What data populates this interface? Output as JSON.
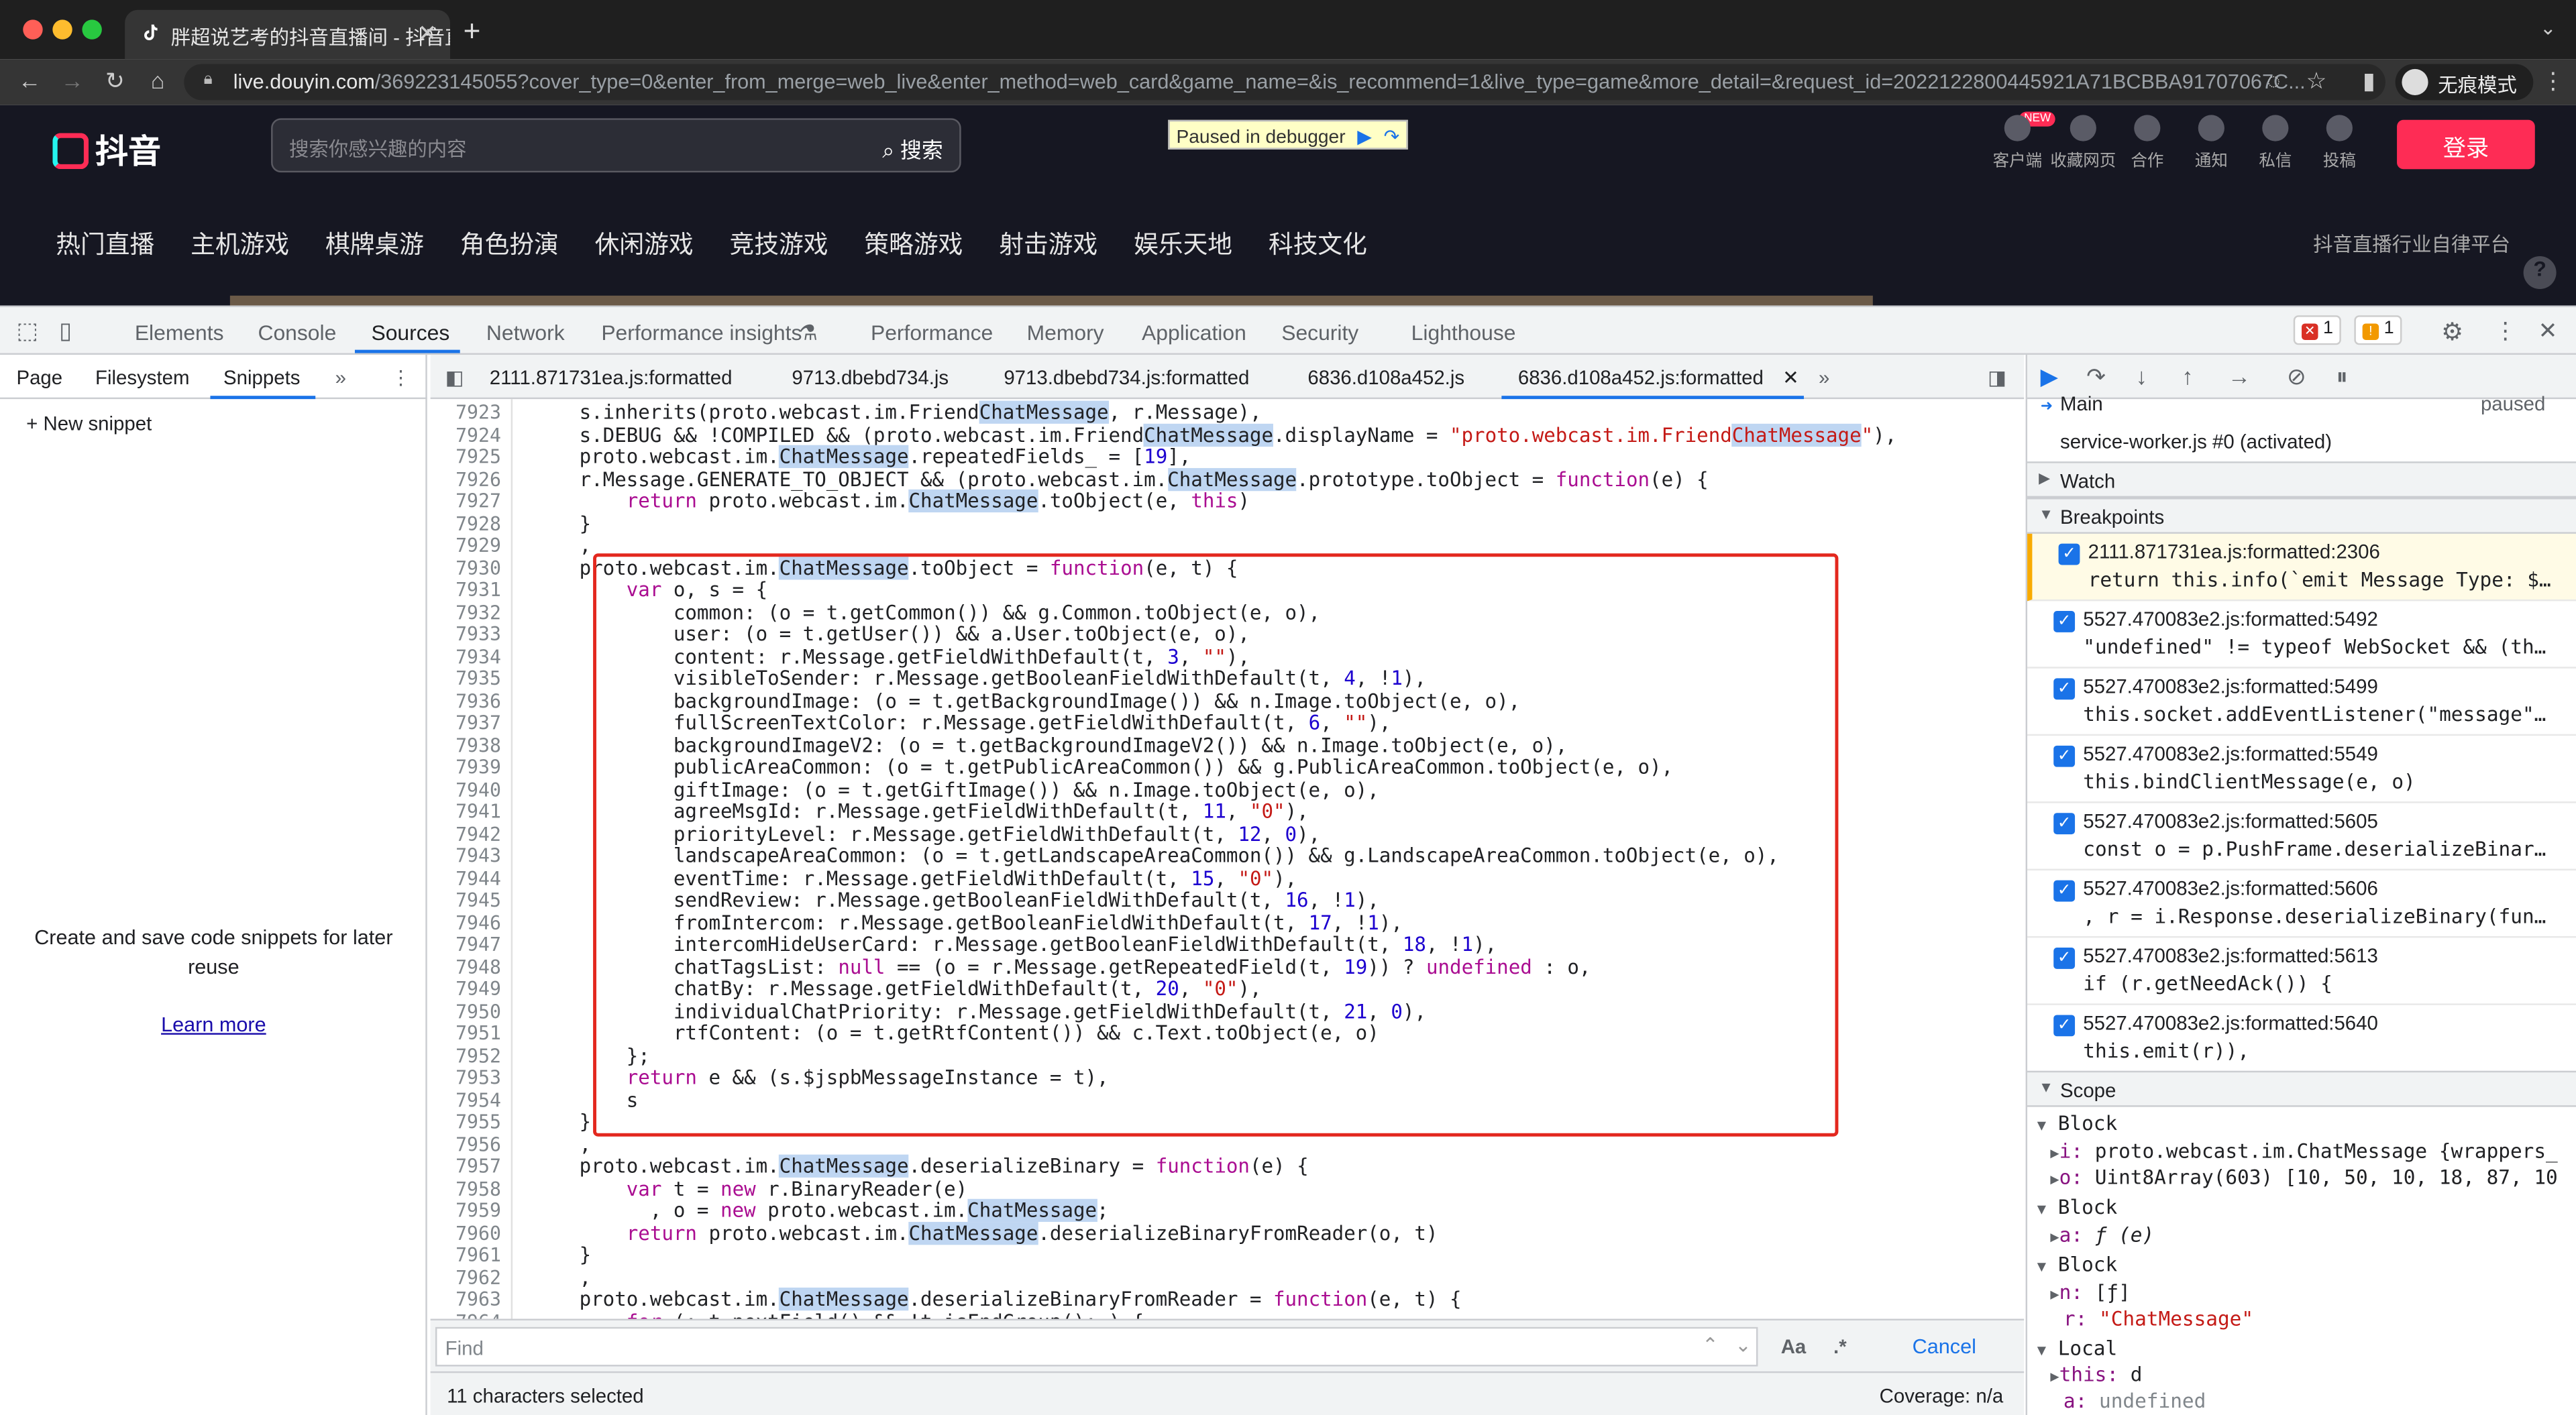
{
  "browser": {
    "tab_title": "胖超说艺考的抖音直播间 - 抖音直播",
    "url_host": "live.douyin.com",
    "url_rest": "/369223145055?cover_type=0&enter_from_merge=web_live&enter_method=web_card&game_name=&is_recommend=1&live_type=game&more_detail=&request_id=2022122800445921A71BCBBA91707067C...",
    "incognito_label": "无痕模式"
  },
  "site": {
    "logo_text": "抖音",
    "search_placeholder": "搜索你感兴趣的内容",
    "search_button": "搜索",
    "paused_label": "Paused in debugger",
    "icons": [
      {
        "label": "客户端",
        "icon": "client-icon"
      },
      {
        "label": "收藏网页",
        "icon": "star-icon"
      },
      {
        "label": "合作",
        "icon": "coop-icon"
      },
      {
        "label": "通知",
        "icon": "bell-icon"
      },
      {
        "label": "私信",
        "icon": "message-icon"
      },
      {
        "label": "投稿",
        "icon": "upload-icon"
      }
    ],
    "new_badge": "NEW",
    "login": "登录",
    "categories": [
      "热门直播",
      "主机游戏",
      "棋牌桌游",
      "角色扮演",
      "休闲游戏",
      "竞技游戏",
      "策略游戏",
      "射击游戏",
      "娱乐天地",
      "科技文化"
    ],
    "self_regulation": "抖音直播行业自律平台",
    "help": "?"
  },
  "devtools": {
    "tabs": [
      "Elements",
      "Console",
      "Sources",
      "Network",
      "Performance insights",
      "Performance",
      "Memory",
      "Application",
      "Security",
      "Lighthouse"
    ],
    "active_tab": "Sources",
    "error_count": "1",
    "warning_count": "1",
    "nav_tabs": [
      "Page",
      "Filesystem",
      "Snippets"
    ],
    "new_snippet": "New snippet",
    "snippet_help": "Create and save code snippets for later reuse",
    "learn_more": "Learn more",
    "editor_tabs": [
      "2111.871731ea.js:formatted",
      "9713.dbebd734.js",
      "9713.dbebd734.js:formatted",
      "6836.d108a452.js",
      "6836.d108a452.js:formatted"
    ],
    "find_placeholder": "Find",
    "find_case": "Aa",
    "find_regex": ".*",
    "cancel": "Cancel",
    "selection_status": "11 characters selected",
    "coverage": "Coverage: n/a"
  },
  "code_lines": [
    {
      "n": "7923",
      "t": "    s.inherits(proto.webcast.im.FriendChatMessage, r.Message),"
    },
    {
      "n": "7924",
      "t": "    s.DEBUG && !COMPILED && (proto.webcast.im.FriendChatMessage.displayName = \"proto.webcast.im.FriendChatMessage\"),"
    },
    {
      "n": "7925",
      "t": "    proto.webcast.im.ChatMessage.repeatedFields_ = [19],"
    },
    {
      "n": "7926",
      "t": "    r.Message.GENERATE_TO_OBJECT && (proto.webcast.im.ChatMessage.prototype.toObject = function(e) {"
    },
    {
      "n": "7927",
      "t": "        return proto.webcast.im.ChatMessage.toObject(e, this)"
    },
    {
      "n": "7928",
      "t": "    }"
    },
    {
      "n": "7929",
      "t": "    ,"
    },
    {
      "n": "7930",
      "t": "    proto.webcast.im.ChatMessage.toObject = function(e, t) {"
    },
    {
      "n": "7931",
      "t": "        var o, s = {"
    },
    {
      "n": "7932",
      "t": "            common: (o = t.getCommon()) && g.Common.toObject(e, o),"
    },
    {
      "n": "7933",
      "t": "            user: (o = t.getUser()) && a.User.toObject(e, o),"
    },
    {
      "n": "7934",
      "t": "            content: r.Message.getFieldWithDefault(t, 3, \"\"),"
    },
    {
      "n": "7935",
      "t": "            visibleToSender: r.Message.getBooleanFieldWithDefault(t, 4, !1),"
    },
    {
      "n": "7936",
      "t": "            backgroundImage: (o = t.getBackgroundImage()) && n.Image.toObject(e, o),"
    },
    {
      "n": "7937",
      "t": "            fullScreenTextColor: r.Message.getFieldWithDefault(t, 6, \"\"),"
    },
    {
      "n": "7938",
      "t": "            backgroundImageV2: (o = t.getBackgroundImageV2()) && n.Image.toObject(e, o),"
    },
    {
      "n": "7939",
      "t": "            publicAreaCommon: (o = t.getPublicAreaCommon()) && g.PublicAreaCommon.toObject(e, o),"
    },
    {
      "n": "7940",
      "t": "            giftImage: (o = t.getGiftImage()) && n.Image.toObject(e, o),"
    },
    {
      "n": "7941",
      "t": "            agreeMsgId: r.Message.getFieldWithDefault(t, 11, \"0\"),"
    },
    {
      "n": "7942",
      "t": "            priorityLevel: r.Message.getFieldWithDefault(t, 12, 0),"
    },
    {
      "n": "7943",
      "t": "            landscapeAreaCommon: (o = t.getLandscapeAreaCommon()) && g.LandscapeAreaCommon.toObject(e, o),"
    },
    {
      "n": "7944",
      "t": "            eventTime: r.Message.getFieldWithDefault(t, 15, \"0\"),"
    },
    {
      "n": "7945",
      "t": "            sendReview: r.Message.getBooleanFieldWithDefault(t, 16, !1),"
    },
    {
      "n": "7946",
      "t": "            fromIntercom: r.Message.getBooleanFieldWithDefault(t, 17, !1),"
    },
    {
      "n": "7947",
      "t": "            intercomHideUserCard: r.Message.getBooleanFieldWithDefault(t, 18, !1),"
    },
    {
      "n": "7948",
      "t": "            chatTagsList: null == (o = r.Message.getRepeatedField(t, 19)) ? undefined : o,"
    },
    {
      "n": "7949",
      "t": "            chatBy: r.Message.getFieldWithDefault(t, 20, \"0\"),"
    },
    {
      "n": "7950",
      "t": "            individualChatPriority: r.Message.getFieldWithDefault(t, 21, 0),"
    },
    {
      "n": "7951",
      "t": "            rtfContent: (o = t.getRtfContent()) && c.Text.toObject(e, o)"
    },
    {
      "n": "7952",
      "t": "        };"
    },
    {
      "n": "7953",
      "t": "        return e && (s.$jspbMessageInstance = t),"
    },
    {
      "n": "7954",
      "t": "        s"
    },
    {
      "n": "7955",
      "t": "    }"
    },
    {
      "n": "7956",
      "t": "    ,"
    },
    {
      "n": "7957",
      "t": "    proto.webcast.im.ChatMessage.deserializeBinary = function(e) {"
    },
    {
      "n": "7958",
      "t": "        var t = new r.BinaryReader(e)"
    },
    {
      "n": "7959",
      "t": "          , o = new proto.webcast.im.ChatMessage;"
    },
    {
      "n": "7960",
      "t": "        return proto.webcast.im.ChatMessage.deserializeBinaryFromReader(o, t)"
    },
    {
      "n": "7961",
      "t": "    }"
    },
    {
      "n": "7962",
      "t": "    ,"
    },
    {
      "n": "7963",
      "t": "    proto.webcast.im.ChatMessage.deserializeBinaryFromReader = function(e, t) {"
    },
    {
      "n": "7964",
      "t": "        for (; t.nextField() && !t.isEndGroup(); ) {"
    }
  ],
  "debugger": {
    "thread_main": "Main",
    "thread_status": "paused",
    "service_worker": "service-worker.js #0 (activated)",
    "watch": "Watch",
    "breakpoints_title": "Breakpoints",
    "breakpoints": [
      {
        "file": "2111.871731ea.js:formatted:2306",
        "code": "return this.info(`emit Message Type: $…"
      },
      {
        "file": "5527.470083e2.js:formatted:5492",
        "code": "\"undefined\" != typeof WebSocket && (th…"
      },
      {
        "file": "5527.470083e2.js:formatted:5499",
        "code": "this.socket.addEventListener(\"message\"…"
      },
      {
        "file": "5527.470083e2.js:formatted:5549",
        "code": "this.bindClientMessage(e, o)"
      },
      {
        "file": "5527.470083e2.js:formatted:5605",
        "code": "const o = p.PushFrame.deserializeBinar…"
      },
      {
        "file": "5527.470083e2.js:formatted:5606",
        "code": ", r = i.Response.deserializeBinary(fun…"
      },
      {
        "file": "5527.470083e2.js:formatted:5613",
        "code": "if (r.getNeedAck()) {"
      },
      {
        "file": "5527.470083e2.js:formatted:5640",
        "code": "this.emit(r)),"
      }
    ],
    "scope_title": "Scope",
    "scope": [
      {
        "kind": "header",
        "text": "Block"
      },
      {
        "kind": "prop",
        "key": "i:",
        "val": "proto.webcast.im.ChatMessage {wrappers_"
      },
      {
        "kind": "prop",
        "key": "o:",
        "val": "Uint8Array(603) [10, 50, 10, 18, 87, 10"
      },
      {
        "kind": "header",
        "text": "Block"
      },
      {
        "kind": "prop",
        "key": "a:",
        "val": "ƒ (e)"
      },
      {
        "kind": "header",
        "text": "Block"
      },
      {
        "kind": "prop",
        "key": "n:",
        "val": "[ƒ]"
      },
      {
        "kind": "plain",
        "key": "r:",
        "val": "\"ChatMessage\""
      },
      {
        "kind": "header",
        "text": "Local"
      },
      {
        "kind": "prop",
        "key": "this:",
        "val": "d"
      },
      {
        "kind": "plain",
        "key": "a:",
        "val": "undefined"
      }
    ]
  },
  "colors": {
    "accent": "#1a73e8",
    "douyin_red": "#fe2c55",
    "highlight_box": "#e3281e"
  }
}
